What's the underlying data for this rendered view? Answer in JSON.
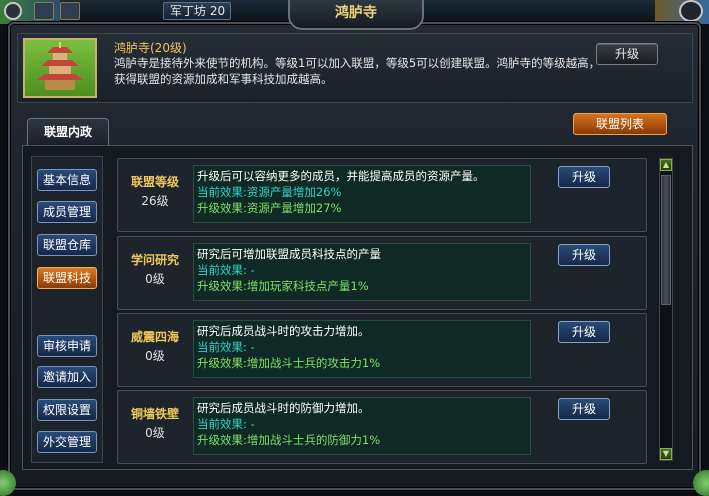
{
  "header": {
    "level_tag": "军丁坊 20",
    "title": "鸿胪寺"
  },
  "building": {
    "name_line": "鸿胪寺(20级)",
    "description": "鸿胪寺是接待外来使节的机构。等级1可以加入联盟，等级5可以创建联盟。鸿胪寺的等级越高，获得联盟的资源加成和军事科技加成越高。",
    "upgrade_label": "升级"
  },
  "tabs": {
    "active_label": "联盟内政",
    "alliance_list_label": "联盟列表"
  },
  "sidebar": {
    "items": [
      {
        "label": "基本信息"
      },
      {
        "label": "成员管理"
      },
      {
        "label": "联盟仓库"
      },
      {
        "label": "联盟科技"
      },
      {
        "label": "审核申请"
      },
      {
        "label": "邀请加入"
      },
      {
        "label": "权限设置"
      },
      {
        "label": "外交管理"
      }
    ],
    "active_index": 3
  },
  "techs": [
    {
      "name": "联盟等级",
      "level": "26级",
      "description": "升级后可以容纳更多的成员，并能提高成员的资源产量。",
      "current_label": "当前效果:",
      "current_value": "资源产量增加26%",
      "next_label": "升级效果:",
      "next_value": "资源产量增加27%",
      "button": "升级"
    },
    {
      "name": "学问研究",
      "level": "0级",
      "description": "研究后可增加联盟成员科技点的产量",
      "current_label": "当前效果:",
      "current_value": " -",
      "next_label": "升级效果:",
      "next_value": "增加玩家科技点产量1%",
      "button": "升级"
    },
    {
      "name": "威震四海",
      "level": "0级",
      "description": "研究后成员战斗时的攻击力增加。",
      "current_label": "当前效果:",
      "current_value": " -",
      "next_label": "升级效果:",
      "next_value": "增加战斗士兵的攻击力1%",
      "button": "升级"
    },
    {
      "name": "铜墙铁壁",
      "level": "0级",
      "description": "研究后成员战斗时的防御力增加。",
      "current_label": "当前效果:",
      "current_value": " -",
      "next_label": "升级效果:",
      "next_value": "增加战斗士兵的防御力1%",
      "button": "升级"
    }
  ],
  "colors": {
    "gold_text": "#f0c85a",
    "cyan_text": "#2fd3c8",
    "green_text": "#7fe069",
    "active_orange": "#db7a1f",
    "side_blue": "#2a4a78"
  }
}
